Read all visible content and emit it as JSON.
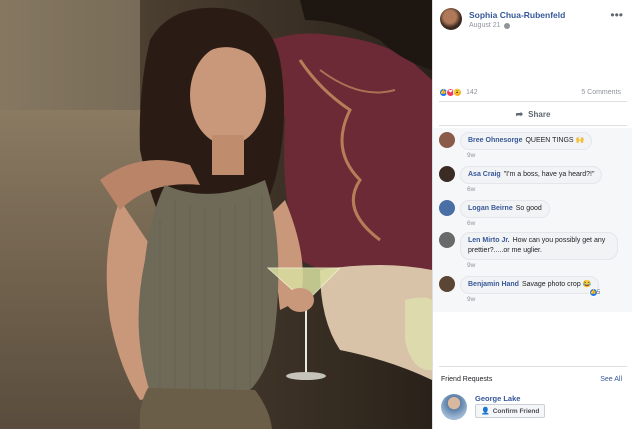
{
  "post": {
    "author": "Sophia Chua-Rubenfeld",
    "date": "August 21",
    "more_icon": "more-icon",
    "reaction_icons": [
      "like-icon",
      "love-icon",
      "wow-icon"
    ],
    "reaction_count": "142",
    "comment_count": "5 Comments",
    "share_label": "Share"
  },
  "comments": [
    {
      "name": "Bree Ohnesorge",
      "text": "QUEEN TINGS 🙌",
      "time": "9w",
      "avatar_color": "#8a5a4a"
    },
    {
      "name": "Asa Craig",
      "text": "\"I'm a boss, have ya heard?!\"",
      "time": "6w",
      "avatar_color": "#3a2c24"
    },
    {
      "name": "Logan Beirne",
      "text": "So good",
      "time": "6w",
      "avatar_color": "#4a6fa5"
    },
    {
      "name": "Len Mirto Jr.",
      "text": "How can you possibly get any prettier?.....or me uglier.",
      "time": "9w",
      "avatar_color": "#6a6a6a"
    },
    {
      "name": "Benjamin Hand",
      "text": "Savage photo crop 😂",
      "time": "9w",
      "avatar_color": "#5b4636",
      "likes": "5"
    }
  ],
  "friend_requests": {
    "title": "Friend Requests",
    "see_all": "See All",
    "name": "George Lake",
    "confirm_label": "Confirm Friend"
  }
}
